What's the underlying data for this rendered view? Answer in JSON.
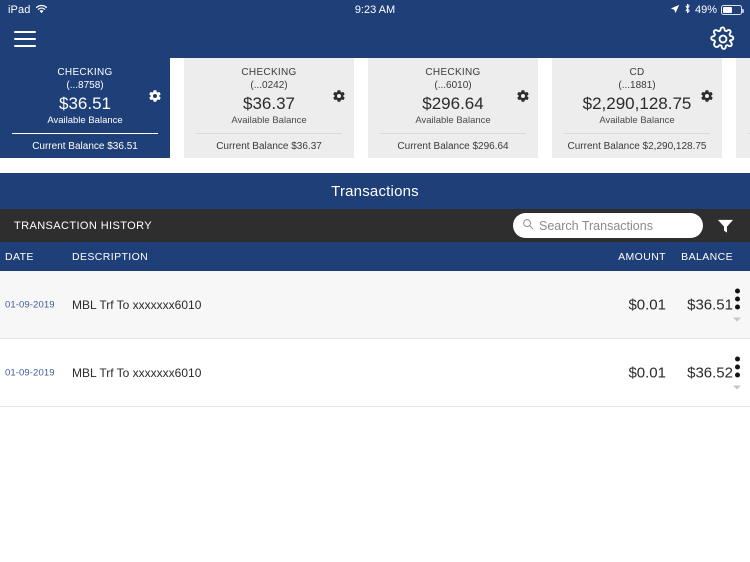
{
  "status_bar": {
    "device": "iPad",
    "wifi_icon": "wifi-icon",
    "time": "9:23 AM",
    "location_icon": "location-arrow-icon",
    "bluetooth_icon": "bluetooth-icon",
    "battery_percent": "49%",
    "battery_icon": "battery-icon"
  },
  "nav": {
    "menu_icon": "hamburger-menu-icon",
    "settings_icon": "gear-icon"
  },
  "accounts": [
    {
      "type": "CHECKING",
      "mask": "(...8758)",
      "available_amount": "$36.51",
      "available_label": "Available Balance",
      "current_balance": "Current Balance $36.51",
      "selected": true,
      "gear_icon": "gear-icon"
    },
    {
      "type": "CHECKING",
      "mask": "(...0242)",
      "available_amount": "$36.37",
      "available_label": "Available Balance",
      "current_balance": "Current Balance $36.37",
      "selected": false,
      "gear_icon": "gear-icon"
    },
    {
      "type": "CHECKING",
      "mask": "(...6010)",
      "available_amount": "$296.64",
      "available_label": "Available Balance",
      "current_balance": "Current Balance $296.64",
      "selected": false,
      "gear_icon": "gear-icon"
    },
    {
      "type": "CD",
      "mask": "(...1881)",
      "available_amount": "$2,290,128.75",
      "available_label": "Available Balance",
      "current_balance": "Current Balance $2,290,128.75",
      "selected": false,
      "gear_icon": "gear-icon"
    }
  ],
  "transactions_section": {
    "title": "Transactions",
    "history_label": "TRANSACTION HISTORY",
    "search_placeholder": "Search Transactions",
    "search_value": "",
    "search_icon": "search-icon",
    "filter_icon": "filter-icon"
  },
  "table": {
    "headers": {
      "date": "DATE",
      "description": "DESCRIPTION",
      "amount": "AMOUNT",
      "balance": "BALANCE"
    },
    "rows": [
      {
        "date": "01-09-2019",
        "description": "MBL Trf To xxxxxxx6010",
        "amount": "$0.01",
        "balance": "$36.51",
        "overflow_icon": "more-vertical-icon",
        "expand_icon": "chevron-down-icon"
      },
      {
        "date": "01-09-2019",
        "description": "MBL Trf To xxxxxxx6010",
        "amount": "$0.01",
        "balance": "$36.52",
        "overflow_icon": "more-vertical-icon",
        "expand_icon": "chevron-down-icon"
      }
    ]
  },
  "colors": {
    "brand_blue": "#1e3f77",
    "dark_bar": "#2e2e2e",
    "card_gray": "#ededed",
    "date_link": "#3e5c96",
    "row_alt": "#f7f7f7"
  }
}
